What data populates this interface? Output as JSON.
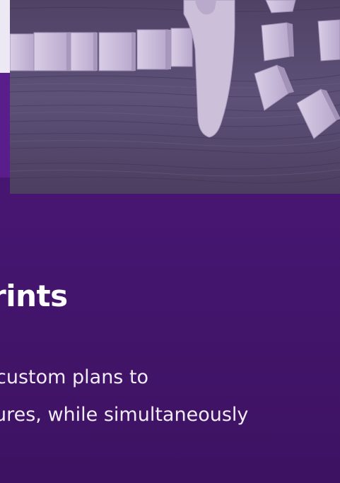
{
  "hero": {
    "image_icon": "dominoes-stopped-by-finger-photo"
  },
  "section": {
    "heading": "rints",
    "body_lines": [
      "custom plans to",
      "ures, while simultaneously"
    ]
  },
  "colors": {
    "background": "#461672",
    "heading_text": "#ffffff",
    "body_text": "#f2ecf7"
  }
}
